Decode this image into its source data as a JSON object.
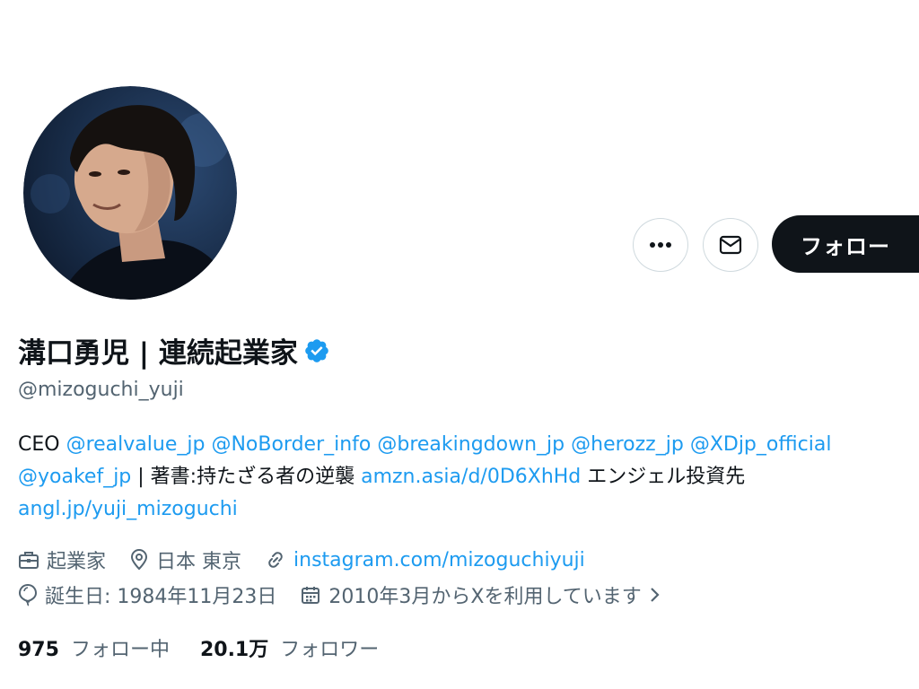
{
  "profile": {
    "display_name": "溝口勇児 | 連続起業家",
    "handle": "@mizoguchi_yuji",
    "verified": true,
    "verified_color": "#1d9bf0"
  },
  "actions": {
    "more_icon": "more-dots-icon",
    "message_icon": "envelope-icon",
    "follow_label": "フォロー"
  },
  "bio": {
    "lines": [
      [
        {
          "text": "CEO ",
          "type": "text"
        },
        {
          "text": "@realvalue_jp",
          "type": "link"
        },
        {
          "text": " ",
          "type": "text"
        },
        {
          "text": "@NoBorder_info",
          "type": "link"
        },
        {
          "text": " ",
          "type": "text"
        },
        {
          "text": "@breakingdown_jp",
          "type": "link"
        },
        {
          "text": " ",
          "type": "text"
        },
        {
          "text": "@herozz_jp",
          "type": "link"
        },
        {
          "text": " ",
          "type": "text"
        },
        {
          "text": "@XDjp_official",
          "type": "link"
        }
      ],
      [
        {
          "text": "@yoakef_jp",
          "type": "link"
        },
        {
          "text": " | 著書:持たざる者の逆襲 ",
          "type": "text"
        },
        {
          "text": "amzn.asia/d/0D6XhHd",
          "type": "link"
        },
        {
          "text": " エンジェル投資先",
          "type": "text"
        }
      ],
      [
        {
          "text": "angl.jp/yuji_mizoguchi",
          "type": "link"
        }
      ]
    ]
  },
  "meta": {
    "profession": "起業家",
    "location": "日本 東京",
    "website": "instagram.com/mizoguchiyuji",
    "birthday": "誕生日: 1984年11月23日",
    "joined": "2010年3月からXを利用しています"
  },
  "stats": {
    "following_count": "975",
    "following_label": "フォロー中",
    "followers_count": "20.1万",
    "followers_label": "フォロワー"
  },
  "colors": {
    "link": "#1d9bf0",
    "text_primary": "#0f1419",
    "text_secondary": "#536471",
    "button_dark": "#0f1419"
  }
}
